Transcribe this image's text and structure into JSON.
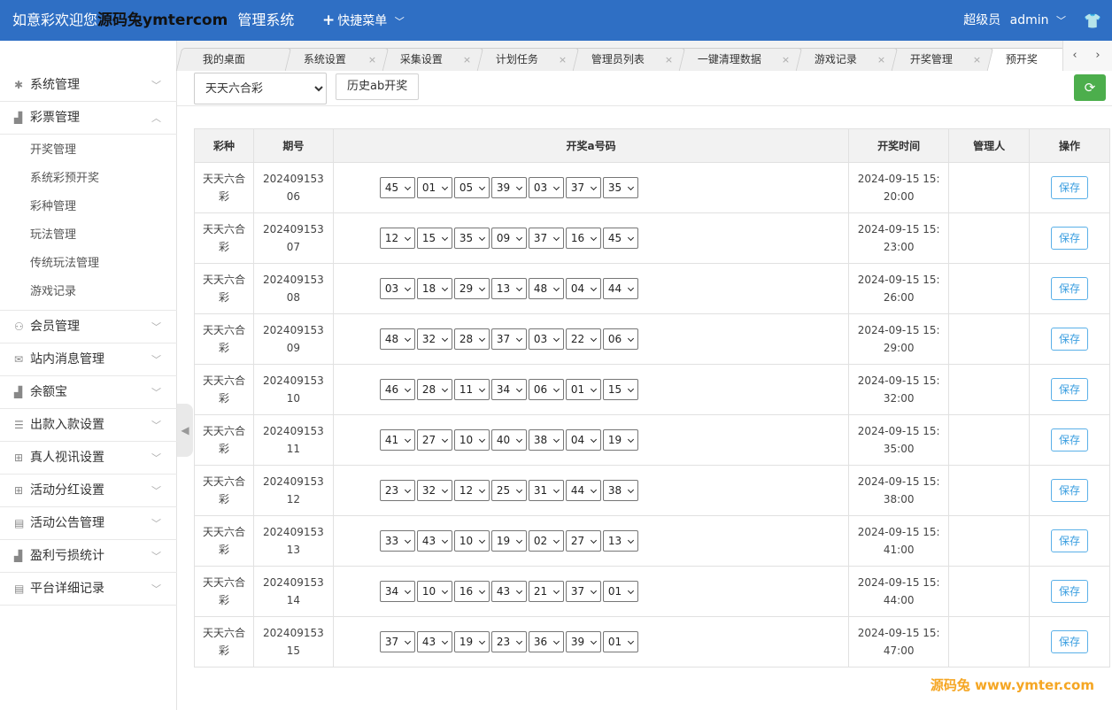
{
  "header": {
    "title_prefix": "如意彩欢迎您",
    "title_watermark": "源码兔ymtercom",
    "title_suffix": "管理系统",
    "quick_menu": "快捷菜单",
    "role": "超级员",
    "username": "admin"
  },
  "sidebar": {
    "groups": [
      {
        "label": "系统管理",
        "icon": "gear-icon",
        "glyph": "✱",
        "expanded": false
      },
      {
        "label": "彩票管理",
        "icon": "chart-icon",
        "glyph": "▟",
        "expanded": true,
        "items": [
          "开奖管理",
          "系统彩预开奖",
          "彩种管理",
          "玩法管理",
          "传统玩法管理",
          "游戏记录"
        ]
      },
      {
        "label": "会员管理",
        "icon": "user-icon",
        "glyph": "⚇",
        "expanded": false
      },
      {
        "label": "站内消息管理",
        "icon": "mail-icon",
        "glyph": "✉",
        "expanded": false
      },
      {
        "label": "余额宝",
        "icon": "chart-icon",
        "glyph": "▟",
        "expanded": false
      },
      {
        "label": "出款入款设置",
        "icon": "list-icon",
        "glyph": "☰",
        "expanded": false
      },
      {
        "label": "真人视讯设置",
        "icon": "gift-icon",
        "glyph": "⊞",
        "expanded": false
      },
      {
        "label": "活动分红设置",
        "icon": "gift-icon",
        "glyph": "⊞",
        "expanded": false
      },
      {
        "label": "活动公告管理",
        "icon": "doc-icon",
        "glyph": "▤",
        "expanded": false
      },
      {
        "label": "盈利亏损统计",
        "icon": "chart-icon",
        "glyph": "▟",
        "expanded": false
      },
      {
        "label": "平台详细记录",
        "icon": "doc-icon",
        "glyph": "▤",
        "expanded": false
      }
    ]
  },
  "tabs": [
    {
      "label": "我的桌面",
      "closable": false
    },
    {
      "label": "系统设置",
      "closable": true
    },
    {
      "label": "采集设置",
      "closable": true
    },
    {
      "label": "计划任务",
      "closable": true
    },
    {
      "label": "管理员列表",
      "closable": true
    },
    {
      "label": "一键清理数据",
      "closable": true
    },
    {
      "label": "游戏记录",
      "closable": true
    },
    {
      "label": "开奖管理",
      "closable": true
    },
    {
      "label": "预开奖",
      "closable": true,
      "active": true
    }
  ],
  "toolbar": {
    "lottery_selected": "天天六合彩",
    "history_button": "历史ab开奖"
  },
  "table": {
    "headers": [
      "彩种",
      "期号",
      "开奖a号码",
      "开奖时间",
      "管理人",
      "操作"
    ],
    "save_label": "保存",
    "rows": [
      {
        "lottery": "天天六合彩",
        "issue": "20240915306",
        "numbers": [
          "45",
          "01",
          "05",
          "39",
          "03",
          "37",
          "35"
        ],
        "time": "2024-09-15 15:20:00",
        "admin": ""
      },
      {
        "lottery": "天天六合彩",
        "issue": "20240915307",
        "numbers": [
          "12",
          "15",
          "35",
          "09",
          "37",
          "16",
          "45"
        ],
        "time": "2024-09-15 15:23:00",
        "admin": ""
      },
      {
        "lottery": "天天六合彩",
        "issue": "20240915308",
        "numbers": [
          "03",
          "18",
          "29",
          "13",
          "48",
          "04",
          "44"
        ],
        "time": "2024-09-15 15:26:00",
        "admin": ""
      },
      {
        "lottery": "天天六合彩",
        "issue": "20240915309",
        "numbers": [
          "48",
          "32",
          "28",
          "37",
          "03",
          "22",
          "06"
        ],
        "time": "2024-09-15 15:29:00",
        "admin": ""
      },
      {
        "lottery": "天天六合彩",
        "issue": "20240915310",
        "numbers": [
          "46",
          "28",
          "11",
          "34",
          "06",
          "01",
          "15"
        ],
        "time": "2024-09-15 15:32:00",
        "admin": ""
      },
      {
        "lottery": "天天六合彩",
        "issue": "20240915311",
        "numbers": [
          "41",
          "27",
          "10",
          "40",
          "38",
          "04",
          "19"
        ],
        "time": "2024-09-15 15:35:00",
        "admin": ""
      },
      {
        "lottery": "天天六合彩",
        "issue": "20240915312",
        "numbers": [
          "23",
          "32",
          "12",
          "25",
          "31",
          "44",
          "38"
        ],
        "time": "2024-09-15 15:38:00",
        "admin": ""
      },
      {
        "lottery": "天天六合彩",
        "issue": "20240915313",
        "numbers": [
          "33",
          "43",
          "10",
          "19",
          "02",
          "27",
          "13"
        ],
        "time": "2024-09-15 15:41:00",
        "admin": ""
      },
      {
        "lottery": "天天六合彩",
        "issue": "20240915314",
        "numbers": [
          "34",
          "10",
          "16",
          "43",
          "21",
          "37",
          "01"
        ],
        "time": "2024-09-15 15:44:00",
        "admin": ""
      },
      {
        "lottery": "天天六合彩",
        "issue": "20240915315",
        "numbers": [
          "37",
          "43",
          "19",
          "23",
          "36",
          "39",
          "01"
        ],
        "time": "2024-09-15 15:47:00",
        "admin": ""
      }
    ]
  },
  "watermark": "源码兔 www.ymter.com"
}
